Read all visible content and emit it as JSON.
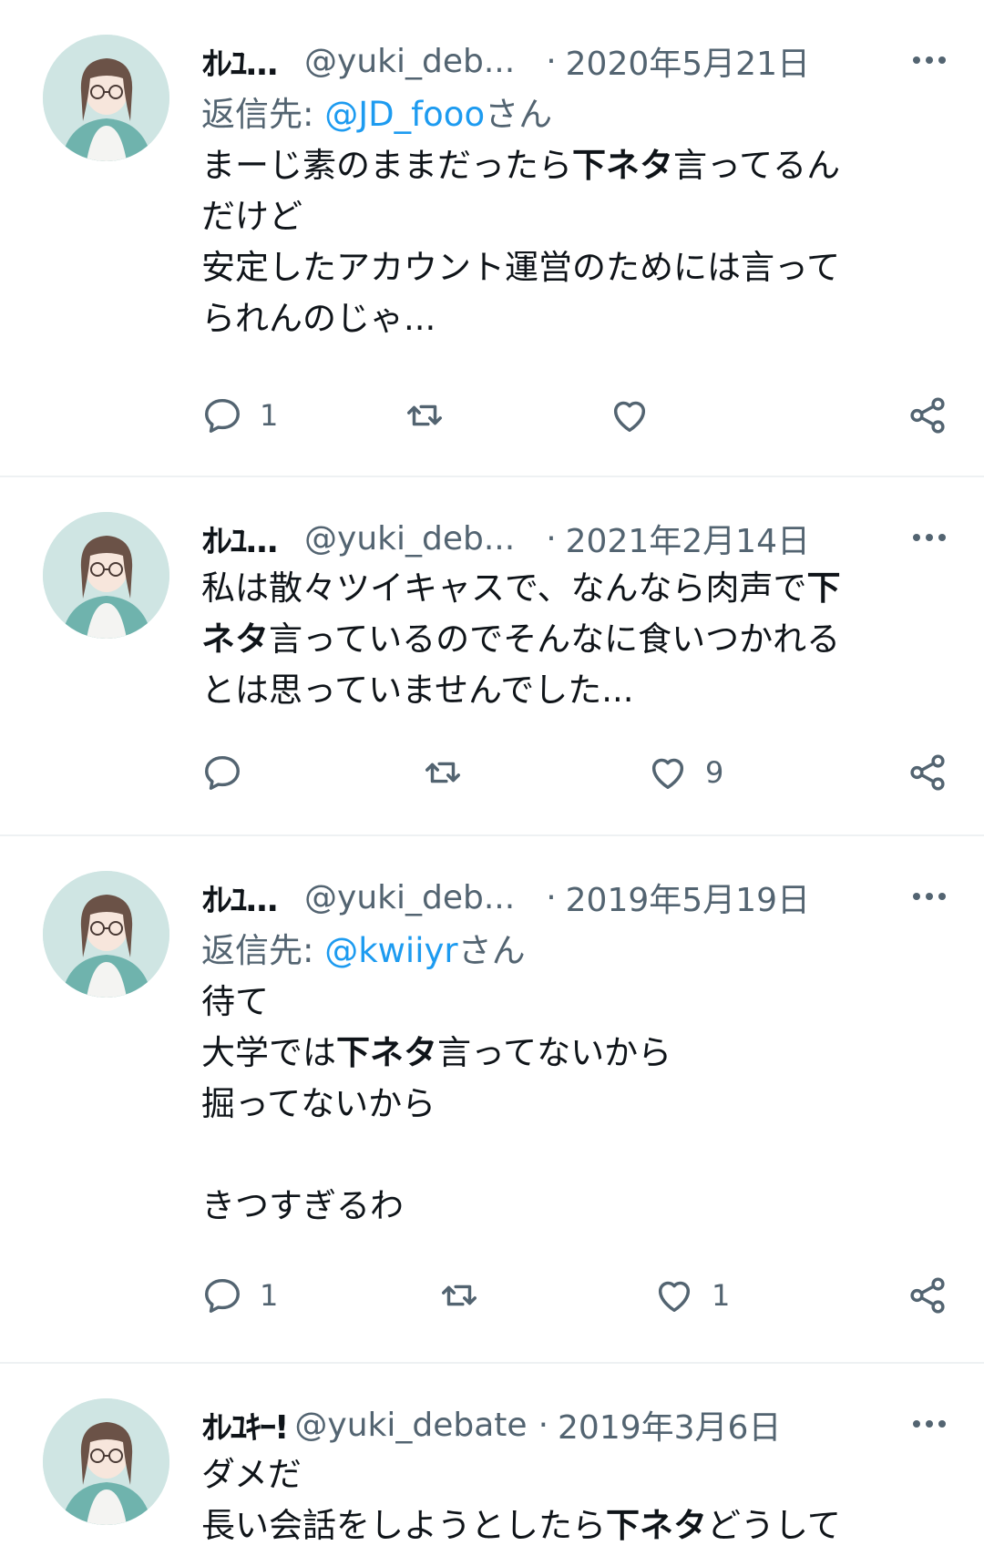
{
  "icons": {
    "reply": "speech-bubble-icon",
    "retweet": "retweet-arrows-icon",
    "like": "heart-icon",
    "share": "share-nodes-icon",
    "more": "ellipsis-icon"
  },
  "colors": {
    "mention": "#1d9bf0",
    "secondary": "#536471",
    "text": "#0f1419"
  },
  "tweets": [
    {
      "name": "ｵﾚﾕ...",
      "handle": "@yuki_deb...",
      "date": "2020年5月21日",
      "reply_prefix": "返信先: ",
      "reply_mention": "@JD_fooo",
      "reply_suffix": "さん",
      "text_a": "まーじ素のままだったら",
      "bold": "下ネタ",
      "text_b": "言ってるん\nだけど\n安定したアカウント運営のためには言って\nられんのじゃ...",
      "reply_count": "1",
      "retweet_count": "",
      "like_count": ""
    },
    {
      "name": "ｵﾚﾕ...",
      "handle": "@yuki_deb...",
      "date": "2021年2月14日",
      "text_a": "私は散々ツイキャスで、なんなら肉声で",
      "bold": "下\nネタ",
      "text_b": "言っているのでそんなに食いつかれる\nとは思っていませんでした...",
      "reply_count": "",
      "retweet_count": "",
      "like_count": "9"
    },
    {
      "name": "ｵﾚﾕ...",
      "handle": "@yuki_deb...",
      "date": "2019年5月19日",
      "reply_prefix": "返信先: ",
      "reply_mention": "@kwiiyr",
      "reply_suffix": "さん",
      "text_a": "待て\n大学では",
      "bold": "下ネタ",
      "text_b": "言ってないから\n掘ってないから\n\nきつすぎるわ",
      "reply_count": "1",
      "retweet_count": "",
      "like_count": "1"
    },
    {
      "name": "ｵﾚﾕｷｰ!",
      "handle": "@yuki_debate",
      "date": "2019年3月6日",
      "text_a": "ダメだ\n長い会話をしようとしたら",
      "bold": "下ネタ",
      "text_b": "どうして"
    }
  ]
}
